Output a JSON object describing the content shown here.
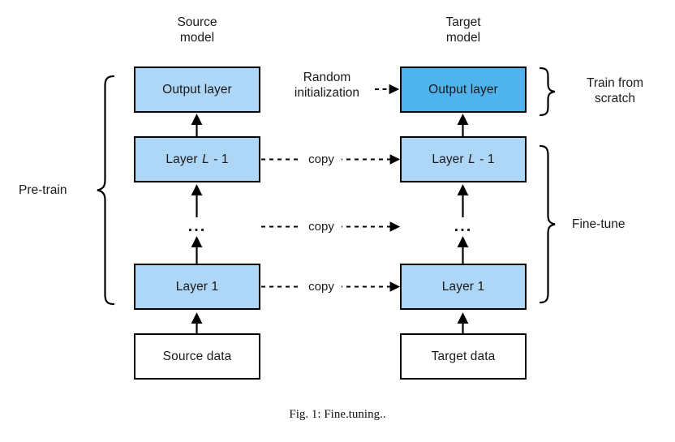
{
  "figure": {
    "caption": "Fig. 1: Fine.tuning..",
    "colors": {
      "box_light_blue": "#aed6f7",
      "box_dark_blue": "#4fb4ee",
      "box_white": "#ffffff",
      "stroke": "#000000",
      "text": "#1a1a1a",
      "background": "#ffffff"
    }
  },
  "columns": {
    "source": {
      "header_line1": "Source",
      "header_line2": "model",
      "boxes": [
        {
          "label": "Output layer",
          "fill": "light"
        },
        {
          "label_prefix": "Layer ",
          "label_italic": "L",
          "label_suffix": " - 1",
          "fill": "light"
        },
        {
          "label": "...",
          "fill": "none"
        },
        {
          "label": "Layer 1",
          "fill": "light"
        },
        {
          "label": "Source data",
          "fill": "plain"
        }
      ]
    },
    "target": {
      "header_line1": "Target",
      "header_line2": "model",
      "boxes": [
        {
          "label": "Output layer",
          "fill": "dark"
        },
        {
          "label_prefix": "Layer ",
          "label_italic": "L",
          "label_suffix": " - 1",
          "fill": "light"
        },
        {
          "label": "...",
          "fill": "none"
        },
        {
          "label": "Layer 1",
          "fill": "light"
        },
        {
          "label": "Target data",
          "fill": "plain"
        }
      ]
    }
  },
  "annotations": {
    "random_init_line1": "Random",
    "random_init_line2": "initialization",
    "copy_1": "copy",
    "copy_2": "copy",
    "copy_3": "copy",
    "pre_train": "Pre-train",
    "train_from_scratch_line1": "Train from",
    "train_from_scratch_line2": "scratch",
    "fine_tune": "Fine-tune"
  }
}
